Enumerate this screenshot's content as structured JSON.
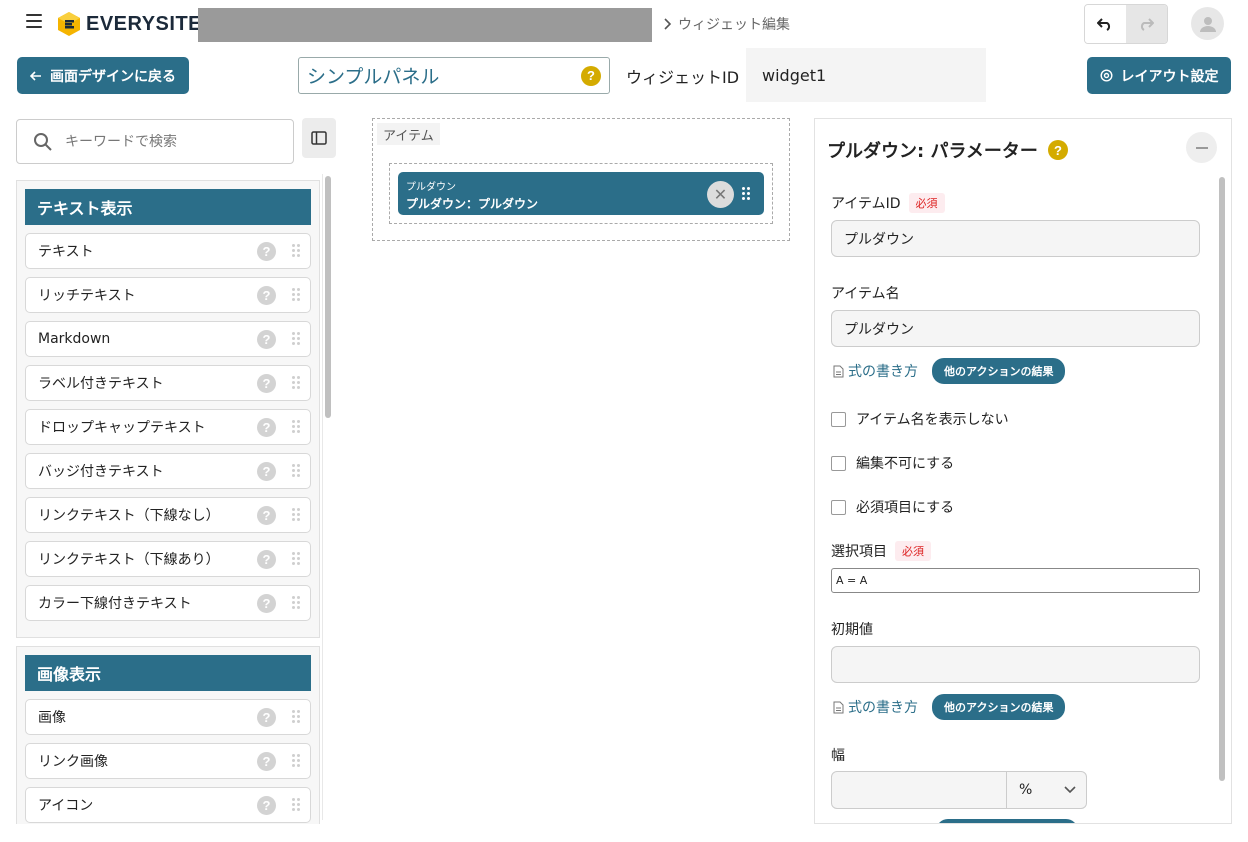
{
  "header": {
    "logo_text": "EVERYSITE",
    "breadcrumb": "ウィジェット編集"
  },
  "toolbar": {
    "back_label": "画面デザインに戻る",
    "panel_name": "シンプルパネル",
    "widget_id_label": "ウィジェットID",
    "widget_id_value": "widget1",
    "layout_label": "レイアウト設定"
  },
  "sidebar": {
    "search_placeholder": "キーワードで検索",
    "sections": [
      {
        "title": "テキスト表示",
        "items": [
          "テキスト",
          "リッチテキスト",
          "Markdown",
          "ラベル付きテキスト",
          "ドロップキャップテキスト",
          "バッジ付きテキスト",
          "リンクテキスト（下線なし）",
          "リンクテキスト（下線あり）",
          "カラー下線付きテキスト"
        ]
      },
      {
        "title": "画像表示",
        "items": [
          "画像",
          "リンク画像",
          "アイコン"
        ]
      }
    ]
  },
  "canvas": {
    "area_label": "アイテム",
    "widget_type": "プルダウン",
    "widget_label": "プルダウン：プルダウン"
  },
  "panel": {
    "title": "プルダウン: パラメーター",
    "required_badge": "必須",
    "item_id_label": "アイテムID",
    "item_id_value": "プルダウン",
    "item_name_label": "アイテム名",
    "item_name_value": "プルダウン",
    "formula_link": "式の書き方",
    "other_action_pill": "他のアクションの結果",
    "checks": [
      "アイテム名を表示しない",
      "編集不可にする",
      "必須項目にする"
    ],
    "options_label": "選択項目",
    "options_value": "A = A",
    "initial_label": "初期値",
    "initial_value": "",
    "width_label": "幅",
    "width_unit": "%"
  },
  "colors": {
    "primary": "#2b6e89",
    "help": "#d4ab00",
    "required_bg": "#fdecef",
    "required_text": "#d22"
  }
}
